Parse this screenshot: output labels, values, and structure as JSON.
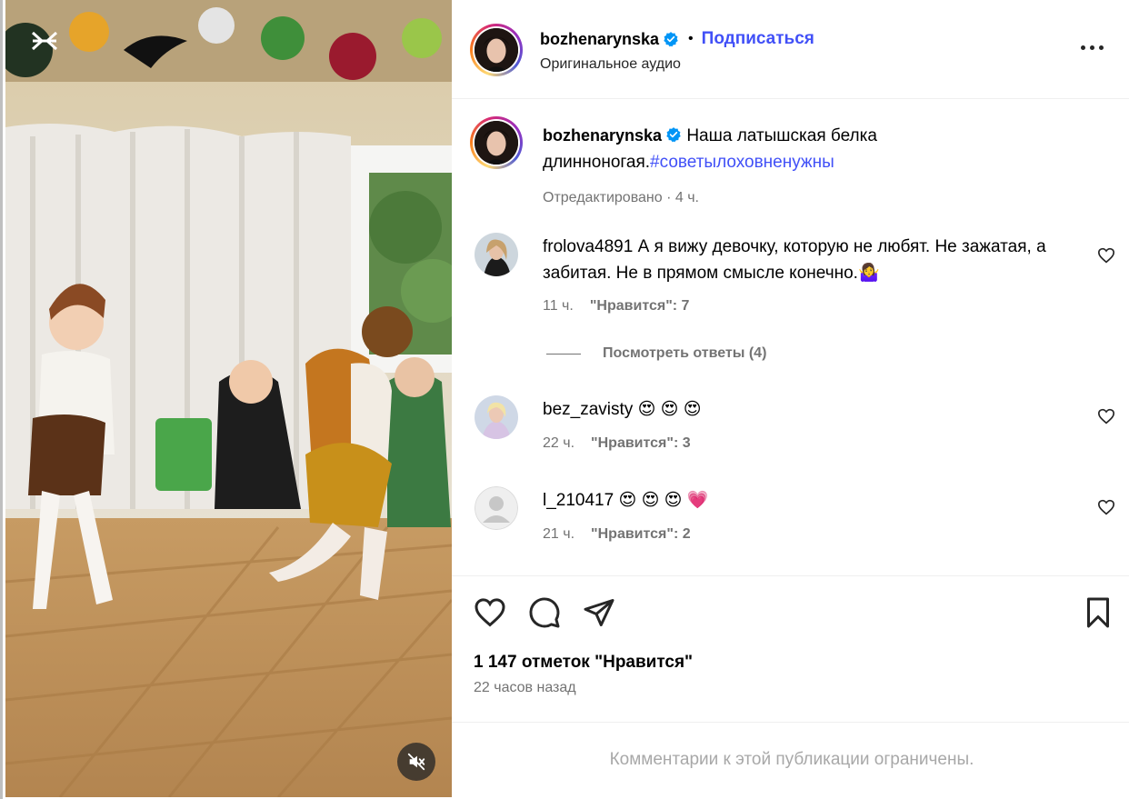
{
  "post": {
    "author": "bozhenarynska",
    "follow_label": "Подписаться",
    "separator": "•",
    "audio_label": "Оригинальное аудио"
  },
  "caption": {
    "author": "bozhenarynska",
    "text": "Наша латышская белка длинноногая.",
    "hashtag": "#советылоховненужны",
    "edited": "Отредактировано",
    "time": "4 ч."
  },
  "comments": [
    {
      "user": "frolova4891",
      "text": "А я вижу девочку, которую не любят. Не зажатая, а забитая. Не в прямом смысле конечно.",
      "emoji": "🤷‍♀️",
      "time": "11 ч.",
      "likes_label": "\"Нравится\": 7"
    },
    {
      "user": "bez_zavisty",
      "text": "",
      "emoji": "😍 😍 😍",
      "time": "22 ч.",
      "likes_label": "\"Нравится\": 3"
    },
    {
      "user": "l_210417",
      "text": "",
      "emoji": "😍 😍 😍 💗",
      "time": "21 ч.",
      "likes_label": "\"Нравится\": 2"
    }
  ],
  "view_replies_label": "Посмотреть ответы (4)",
  "likes_count_label": "1 147 отметок \"Нравится\"",
  "posted_time": "22 часов назад",
  "comments_restricted": "Комментарии к этой публикации ограничены.",
  "colors": {
    "link_blue": "#4150f7",
    "verified_blue": "#0095f6",
    "secondary_text": "#737373"
  },
  "icons": [
    "capcut-logo-icon",
    "mute-icon",
    "more-options-icon",
    "verified-badge-icon",
    "heart-icon",
    "comment-icon",
    "share-icon",
    "bookmark-icon",
    "default-avatar-icon"
  ]
}
